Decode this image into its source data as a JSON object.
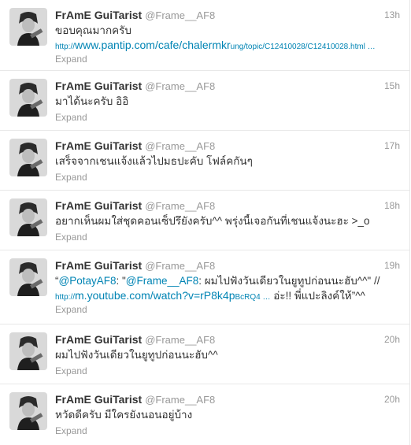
{
  "tweets": [
    {
      "fullname": "FrAmE GuiTarist",
      "username": "@Frame__AF8",
      "time": "13h",
      "text": "ขอบคุณมากครับ",
      "link_prefix": "http://",
      "link_main": "www.pantip.com/cafe/chalermkr",
      "link_tail": "ung/topic/C12410028/C12410028.html …",
      "expand": "Expand"
    },
    {
      "fullname": "FrAmE GuiTarist",
      "username": "@Frame__AF8",
      "time": "15h",
      "text": "มาได้นะครับ อิอิ",
      "expand": "Expand"
    },
    {
      "fullname": "FrAmE GuiTarist",
      "username": "@Frame__AF8",
      "time": "17h",
      "text": "เสร็จจากเชนแจ้งแล้วไปมธปะคับ โฟล์คกันๆ",
      "expand": "Expand"
    },
    {
      "fullname": "FrAmE GuiTarist",
      "username": "@Frame__AF8",
      "time": "18h",
      "text": "อยากเห็นผมใส่ชุดคอนเซ็ปรึยังครับ^^ พรุ่งนี้เจอกันที่เชนแจ้งนะฮะ >_o",
      "expand": "Expand"
    },
    {
      "fullname": "FrAmE GuiTarist",
      "username": "@Frame__AF8",
      "time": "19h",
      "quote_open": "“",
      "mention1": "@PotayAF8",
      "sep1": ": \"",
      "mention2": "@Frame__AF8",
      "quote_text": ": ผมไปฟังวันเดียวในยูทูปก่อนนะฮับ^^\" //",
      "link_prefix": "http://",
      "link_main": "m.youtube.com/watch?v=rP8k4p",
      "link_tail": "BcRQ4 …",
      "after_link": " อ่ะ!! พี่แปะลิงค์ให้”^^",
      "expand": "Expand"
    },
    {
      "fullname": "FrAmE GuiTarist",
      "username": "@Frame__AF8",
      "time": "20h",
      "text": "ผมไปฟังวันเดียวในยูทูปก่อนนะฮับ^^",
      "expand": "Expand"
    },
    {
      "fullname": "FrAmE GuiTarist",
      "username": "@Frame__AF8",
      "time": "20h",
      "text": "หวัดดีครับ มีใครยังนอนอยู่บ้าง",
      "expand": "Expand"
    }
  ]
}
